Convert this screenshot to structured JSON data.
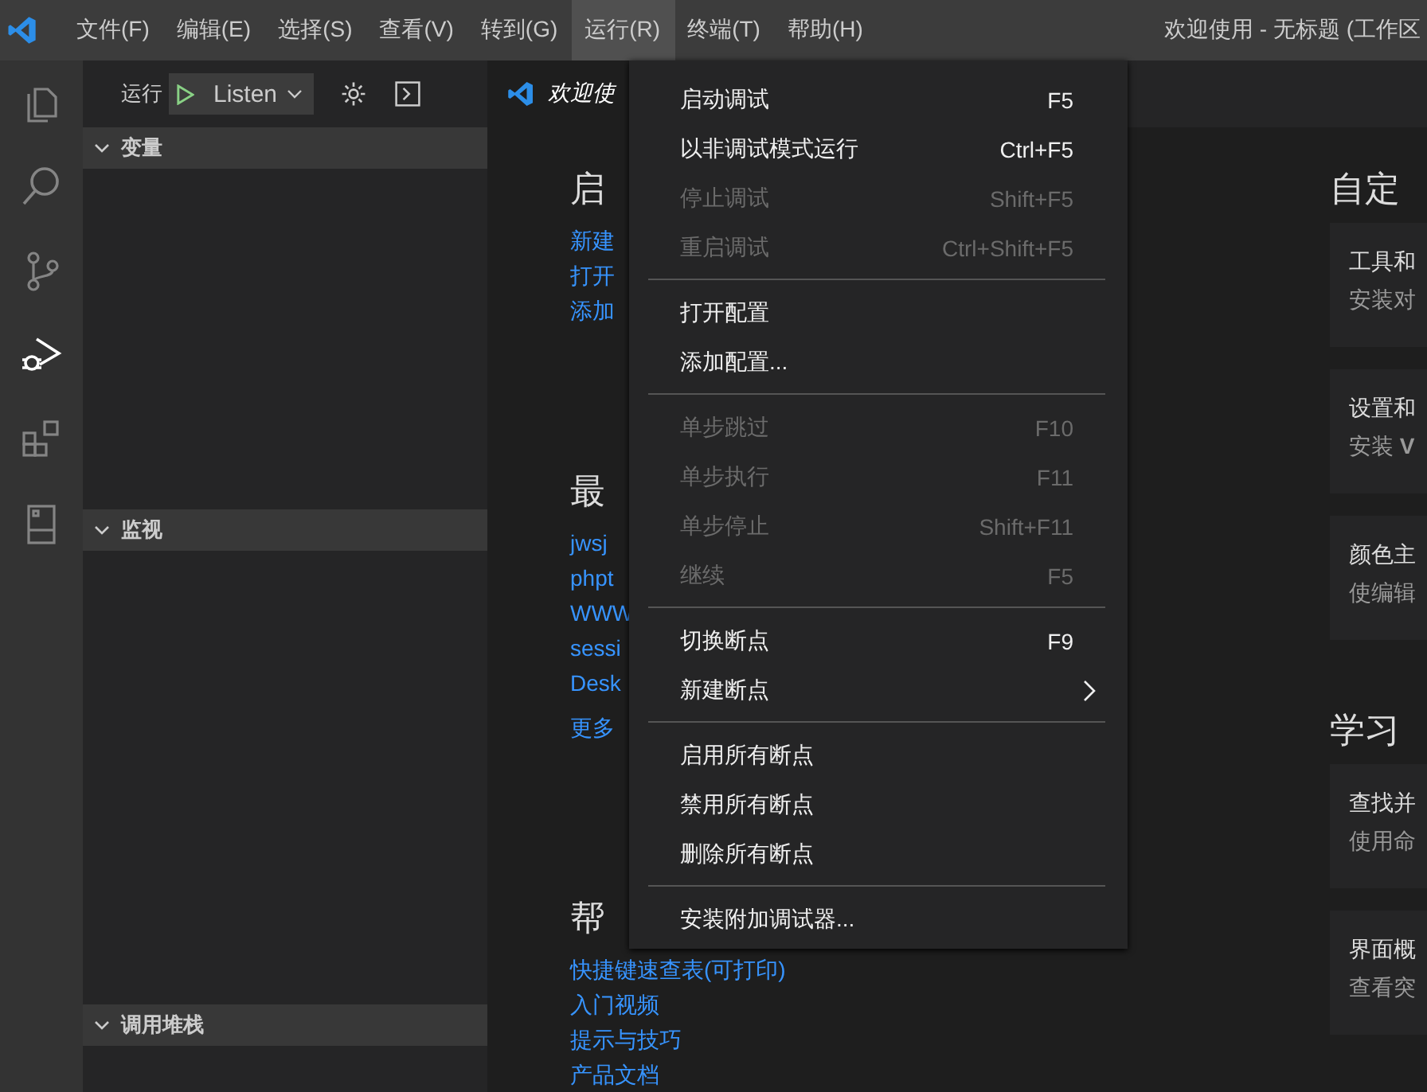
{
  "window": {
    "title": "欢迎使用 - 无标题 (工作区"
  },
  "menubar": [
    {
      "label": "文件(F)",
      "selected": false
    },
    {
      "label": "编辑(E)",
      "selected": false
    },
    {
      "label": "选择(S)",
      "selected": false
    },
    {
      "label": "查看(V)",
      "selected": false
    },
    {
      "label": "转到(G)",
      "selected": false
    },
    {
      "label": "运行(R)",
      "selected": true
    },
    {
      "label": "终端(T)",
      "selected": false
    },
    {
      "label": "帮助(H)",
      "selected": false
    }
  ],
  "activity_bar": [
    {
      "kind": "files",
      "selected": false
    },
    {
      "kind": "search",
      "selected": false
    },
    {
      "kind": "source-control",
      "selected": false
    },
    {
      "kind": "run",
      "selected": true
    },
    {
      "kind": "extensions",
      "selected": false
    },
    {
      "kind": "panel",
      "selected": false
    }
  ],
  "sidebar": {
    "title": "运行",
    "config": "Listen",
    "sections": [
      {
        "label": "变量",
        "expanded": true
      },
      {
        "label": "监视",
        "expanded": true
      },
      {
        "label": "调用堆栈",
        "expanded": true
      }
    ]
  },
  "editor": {
    "tab": {
      "label": "欢迎使",
      "selected": true
    },
    "left": [
      {
        "heading": "启",
        "links": [
          "新建",
          "打开",
          "添加"
        ]
      },
      {
        "heading": "最",
        "links": [
          "jwsj",
          "phpt",
          "WWW",
          "sessi",
          "Desk"
        ],
        "more": "更多"
      },
      {
        "heading": "帮",
        "links": [
          "快捷键速查表(可打印)",
          "入门视频",
          "提示与技巧",
          "产品文档"
        ]
      }
    ],
    "right": [
      {
        "heading": "自定",
        "cards": [
          {
            "title": "工具和",
            "text": "安装对"
          },
          {
            "title": "设置和",
            "text": "安装 **V**"
          },
          {
            "title": "颜色主",
            "text": "使编辑"
          }
        ]
      },
      {
        "heading": "学习",
        "cards": [
          {
            "title": "查找并",
            "text": "使用命"
          },
          {
            "title": "界面概",
            "text": "查看突"
          }
        ]
      }
    ]
  },
  "menu": [
    {
      "kind": "item",
      "label": "启动调试",
      "shortcut": "F5",
      "disabled": false
    },
    {
      "kind": "item",
      "label": "以非调试模式运行",
      "shortcut": "Ctrl+F5",
      "disabled": false
    },
    {
      "kind": "item",
      "label": "停止调试",
      "shortcut": "Shift+F5",
      "disabled": true
    },
    {
      "kind": "item",
      "label": "重启调试",
      "shortcut": "Ctrl+Shift+F5",
      "disabled": true
    },
    {
      "kind": "separator"
    },
    {
      "kind": "item",
      "label": "打开配置",
      "disabled": false
    },
    {
      "kind": "item",
      "label": "添加配置...",
      "disabled": false
    },
    {
      "kind": "separator"
    },
    {
      "kind": "item",
      "label": "单步跳过",
      "shortcut": "F10",
      "disabled": true
    },
    {
      "kind": "item",
      "label": "单步执行",
      "shortcut": "F11",
      "disabled": true
    },
    {
      "kind": "item",
      "label": "单步停止",
      "shortcut": "Shift+F11",
      "disabled": true
    },
    {
      "kind": "item",
      "label": "继续",
      "shortcut": "F5",
      "disabled": true
    },
    {
      "kind": "separator"
    },
    {
      "kind": "item",
      "label": "切换断点",
      "shortcut": "F9",
      "disabled": false
    },
    {
      "kind": "submenu",
      "label": "新建断点",
      "disabled": false
    },
    {
      "kind": "separator"
    },
    {
      "kind": "item",
      "label": "启用所有断点",
      "disabled": false
    },
    {
      "kind": "item",
      "label": "禁用所有断点",
      "disabled": false
    },
    {
      "kind": "item",
      "label": "删除所有断点",
      "disabled": false
    },
    {
      "kind": "separator"
    },
    {
      "kind": "item",
      "label": "安装附加调试器...",
      "disabled": false
    }
  ]
}
